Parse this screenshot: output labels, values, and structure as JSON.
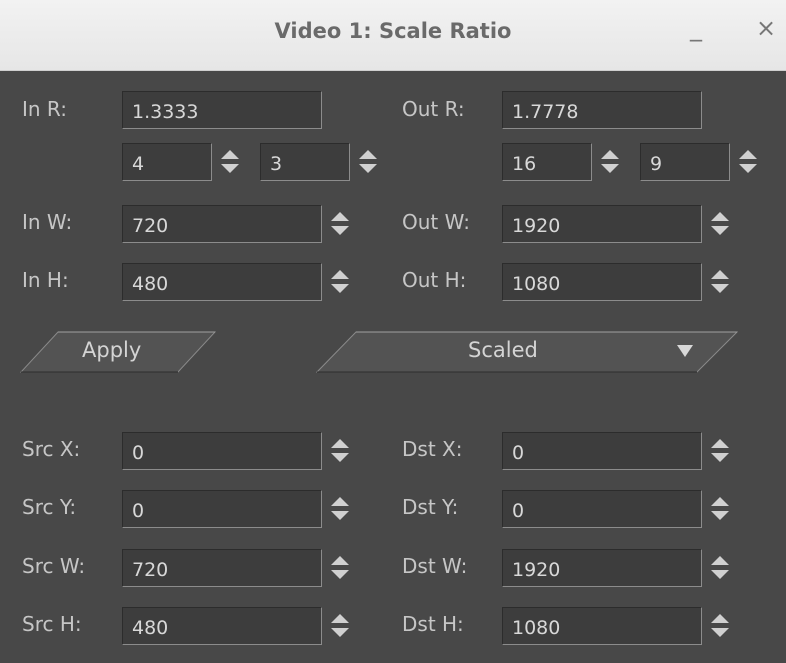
{
  "window": {
    "title": "Video 1: Scale Ratio",
    "minimize": "_",
    "close": "×"
  },
  "in_r": {
    "label": "In R:",
    "value": "1.3333",
    "num": "4",
    "den": "3"
  },
  "out_r": {
    "label": "Out R:",
    "value": "1.7778",
    "num": "16",
    "den": "9"
  },
  "in_w": {
    "label": "In W:",
    "value": "720"
  },
  "in_h": {
    "label": "In H:",
    "value": "480"
  },
  "out_w": {
    "label": "Out W:",
    "value": "1920"
  },
  "out_h": {
    "label": "Out H:",
    "value": "1080"
  },
  "apply_label": "Apply",
  "mode": {
    "selected": "Scaled"
  },
  "src_x": {
    "label": "Src X:",
    "value": "0"
  },
  "src_y": {
    "label": "Src Y:",
    "value": "0"
  },
  "src_w": {
    "label": "Src W:",
    "value": "720"
  },
  "src_h": {
    "label": "Src H:",
    "value": "480"
  },
  "dst_x": {
    "label": "Dst X:",
    "value": "0"
  },
  "dst_y": {
    "label": "Dst Y:",
    "value": "0"
  },
  "dst_w": {
    "label": "Dst W:",
    "value": "1920"
  },
  "dst_h": {
    "label": "Dst H:",
    "value": "1080"
  }
}
